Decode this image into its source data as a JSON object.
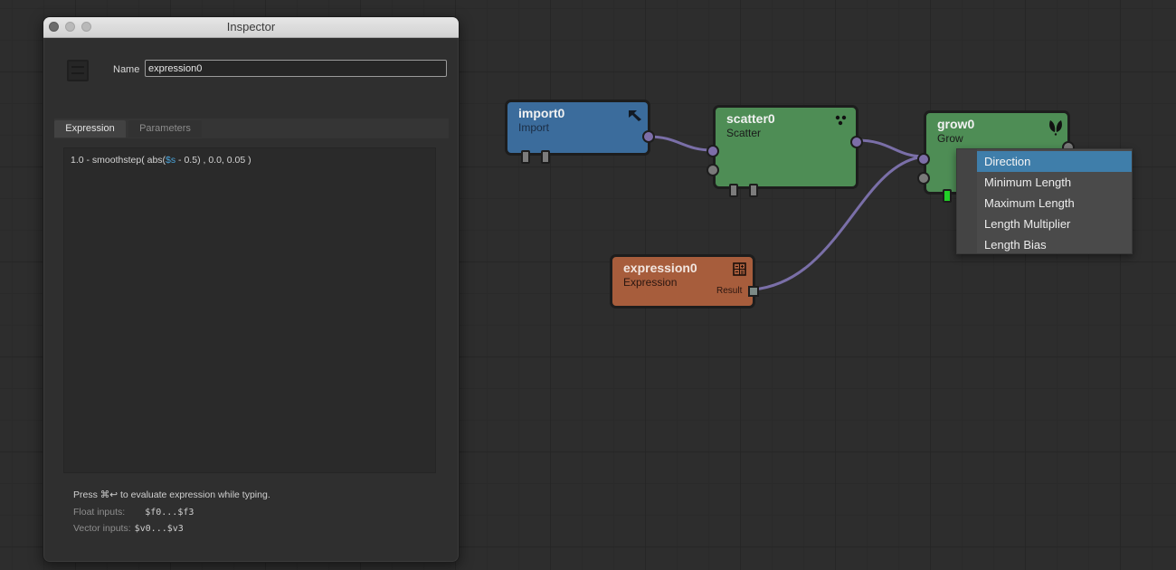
{
  "inspector": {
    "title": "Inspector",
    "name_label": "Name",
    "name_value": "expression0",
    "tabs": [
      {
        "label": "Expression",
        "active": true
      },
      {
        "label": "Parameters",
        "active": false
      }
    ],
    "expression": {
      "before_var": "1.0 - smoothstep( abs(",
      "var": "$s",
      "after_var": " - 0.5) , 0.0, 0.05 )"
    },
    "help": {
      "line1": "Press ⌘↩ to evaluate expression while typing.",
      "float_label": "Float inputs:",
      "float_value": "$f0...$f3",
      "vector_label": "Vector inputs:",
      "vector_value": "$v0...$v3"
    }
  },
  "nodes": [
    {
      "id": "import0",
      "title": "import0",
      "type": "Import",
      "color": "#3b6c9c",
      "icon": "arrow-cursor-icon"
    },
    {
      "id": "scatter0",
      "title": "scatter0",
      "type": "Scatter",
      "color": "#4e8d55",
      "icon": "dots-icon"
    },
    {
      "id": "grow0",
      "title": "grow0",
      "type": "Grow",
      "color": "#4e8d55",
      "icon": "leaf-icon"
    },
    {
      "id": "expression0",
      "title": "expression0",
      "type": "Expression",
      "color": "#a75d3c",
      "icon": "calculator-icon",
      "output_label": "Result"
    }
  ],
  "connections": [
    {
      "from": "import0",
      "to": "scatter0"
    },
    {
      "from": "scatter0",
      "to": "grow0"
    },
    {
      "from": "expression0.Result",
      "to": "grow0"
    }
  ],
  "menu": {
    "items": [
      {
        "label": "Direction",
        "selected": true
      },
      {
        "label": "Minimum Length",
        "selected": false
      },
      {
        "label": "Maximum Length",
        "selected": false
      },
      {
        "label": "Length Multiplier",
        "selected": false
      },
      {
        "label": "Length Bias",
        "selected": false
      }
    ]
  },
  "colors": {
    "wire": "#7a6fa8",
    "selection": "#3f7eaa",
    "active_port": "#21d127"
  }
}
